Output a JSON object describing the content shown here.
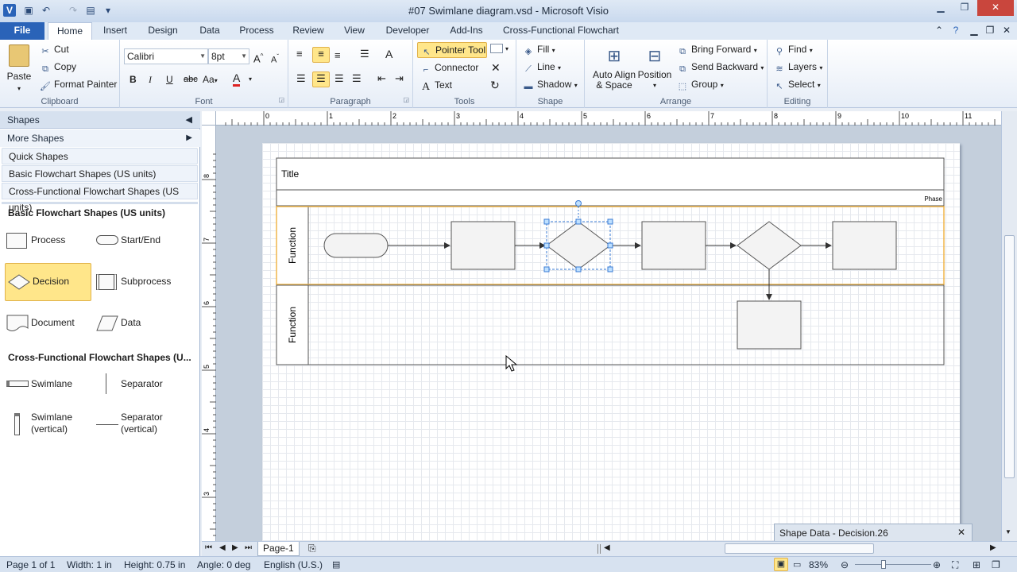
{
  "window": {
    "title": "#07 Swimlane diagram.vsd - Microsoft Visio"
  },
  "tabs": [
    "File",
    "Home",
    "Insert",
    "Design",
    "Data",
    "Process",
    "Review",
    "View",
    "Developer",
    "Add-Ins",
    "Cross-Functional Flowchart"
  ],
  "ribbon": {
    "clipboard": {
      "paste": "Paste",
      "cut": "Cut",
      "copy": "Copy",
      "format_painter": "Format Painter",
      "label": "Clipboard"
    },
    "font": {
      "family": "Calibri",
      "size": "8pt",
      "label": "Font",
      "bold": "B",
      "italic": "I",
      "underline": "U",
      "strike": "abc",
      "case": "Aa",
      "color": "A"
    },
    "paragraph": {
      "label": "Paragraph"
    },
    "tools": {
      "pointer": "Pointer Tool",
      "connector": "Connector",
      "text": "Text",
      "label": "Tools"
    },
    "shape": {
      "fill": "Fill",
      "line": "Line",
      "shadow": "Shadow",
      "label": "Shape"
    },
    "arrange": {
      "auto_align_line1": "Auto Align",
      "auto_align_line2": "& Space",
      "position": "Position",
      "bring_forward": "Bring Forward",
      "send_backward": "Send Backward",
      "group": "Group",
      "label": "Arrange"
    },
    "editing": {
      "find": "Find",
      "layers": "Layers",
      "select": "Select",
      "label": "Editing"
    }
  },
  "shapes_pane": {
    "title": "Shapes",
    "more_shapes": "More Shapes",
    "stencils": [
      "Quick Shapes",
      "Basic Flowchart Shapes (US units)",
      "Cross-Functional Flowchart Shapes (US units)"
    ],
    "section1_title": "Basic Flowchart Shapes (US units)",
    "section1_items": [
      "Process",
      "Start/End",
      "Decision",
      "Subprocess",
      "Document",
      "Data"
    ],
    "section2_title": "Cross-Functional Flowchart Shapes (U...",
    "section2_items": [
      "Swimlane",
      "Separator",
      "Swimlane (vertical)",
      "Separator (vertical)"
    ]
  },
  "ruler": {
    "h_ticks": [
      "0",
      "1",
      "2",
      "3",
      "4",
      "5",
      "6",
      "7",
      "8",
      "9",
      "10",
      "11"
    ],
    "v_ticks": [
      "8",
      "7",
      "6",
      "5",
      "4",
      "3"
    ]
  },
  "diagram": {
    "title": "Title",
    "phase": "Phase",
    "lanes": [
      "Function",
      "Function"
    ]
  },
  "shape_data": {
    "title": "Shape Data - Decision.26"
  },
  "page_tab": "Page-1",
  "status": {
    "page": "Page 1 of 1",
    "width": "Width: 1 in",
    "height": "Height: 0.75 in",
    "angle": "Angle: 0 deg",
    "language": "English (U.S.)",
    "zoom": "83%"
  }
}
